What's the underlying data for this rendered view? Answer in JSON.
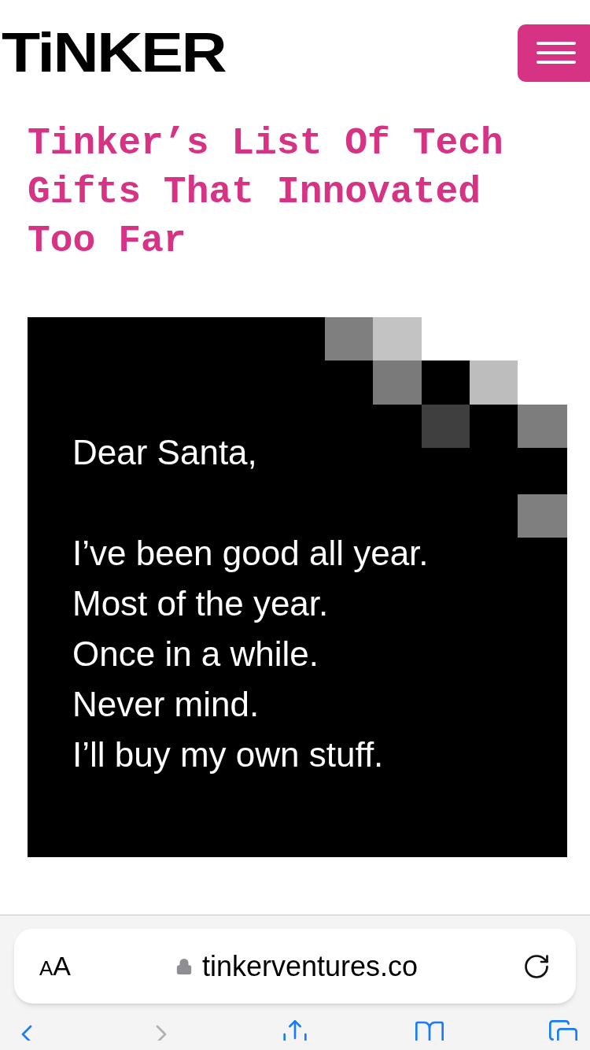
{
  "header": {
    "logo": "TiNKER"
  },
  "article": {
    "title": "Tinker’s List Of Tech Gifts That Innovated Too Far",
    "image": {
      "paragraphs": [
        [
          "Dear Santa,"
        ],
        [
          "I’ve been good all year.",
          "Most of the year.",
          "Once in a while.",
          "Never mind.",
          "I’ll buy my own stuff."
        ]
      ]
    }
  },
  "browser": {
    "text_size_button": "AA",
    "url": "tinkerventures.co",
    "toolbar": [
      {
        "kind": "back",
        "disabled": false
      },
      {
        "kind": "forward",
        "disabled": true
      },
      {
        "kind": "share",
        "disabled": false
      },
      {
        "kind": "bookmarks",
        "disabled": false
      },
      {
        "kind": "tabs",
        "disabled": false
      }
    ]
  }
}
